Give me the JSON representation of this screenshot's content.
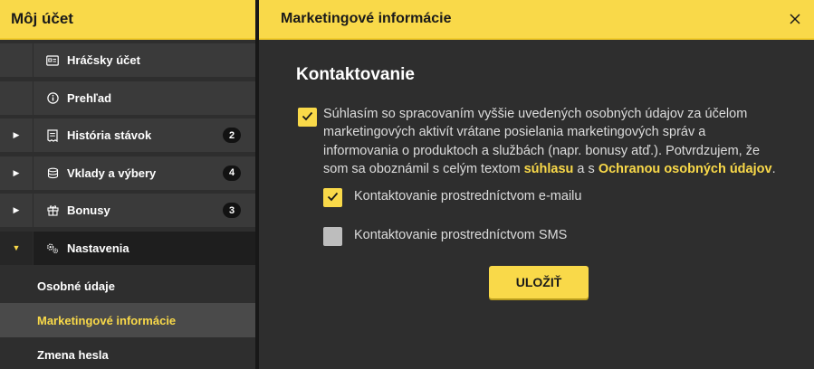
{
  "sidebar": {
    "title": "Môj účet",
    "items": [
      {
        "label": "Hráčsky účet",
        "icon": "id-card-icon",
        "badge": null,
        "arrow": false
      },
      {
        "label": "Prehľad",
        "icon": "info-icon",
        "badge": null,
        "arrow": false
      },
      {
        "label": "História stávok",
        "icon": "receipt-icon",
        "badge": "2",
        "arrow": true
      },
      {
        "label": "Vklady a výbery",
        "icon": "coins-icon",
        "badge": "4",
        "arrow": true
      },
      {
        "label": "Bonusy",
        "icon": "gift-icon",
        "badge": "3",
        "arrow": true
      },
      {
        "label": "Nastavenia",
        "icon": "gears-icon",
        "badge": null,
        "arrow": true,
        "open": true
      }
    ],
    "subitems": [
      {
        "label": "Osobné údaje",
        "active": false
      },
      {
        "label": "Marketingové informácie",
        "active": true
      },
      {
        "label": "Zmena hesla",
        "active": false
      }
    ]
  },
  "main": {
    "title": "Marketingové informácie",
    "section_title": "Kontaktovanie",
    "consent": {
      "text_before": "Súhlasím so spracovaním vyššie uvedených osobných údajov za účelom marketingových aktivít vrátane posielania marketingových správ a informovania o produktoch a službách (napr. bonusy atď.). Potvrdzujem, že som sa oboznámil s celým textom ",
      "link1": "súhlasu",
      "text_mid": " a s ",
      "link2": "Ochranou osobných údajov",
      "text_after": ".",
      "checked": true
    },
    "options": [
      {
        "label": "Kontaktovanie prostredníctvom e-mailu",
        "checked": true
      },
      {
        "label": "Kontaktovanie prostredníctvom SMS",
        "checked": false
      }
    ],
    "save_label": "ULOŽIŤ"
  },
  "colors": {
    "accent": "#f9d949",
    "panel": "#2e2e2e",
    "row": "#3a3a3a",
    "active_sub": "#4a4a4a"
  }
}
